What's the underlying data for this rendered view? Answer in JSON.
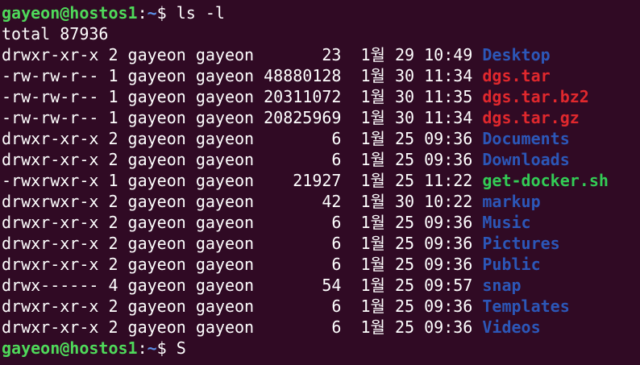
{
  "prompt": {
    "user_host": "gayeon@hostos1",
    "separator": ":",
    "path": "~",
    "symbol": "$"
  },
  "command": "ls -l",
  "total": "total 87936",
  "entries": [
    {
      "perms": "drwxr-xr-x",
      "links": "2",
      "owner": "gayeon",
      "group": "gayeon",
      "size": "23",
      "month": "1월",
      "day": "29",
      "time": "10:49",
      "name": "Desktop",
      "kind": "dir"
    },
    {
      "perms": "-rw-rw-r--",
      "links": "1",
      "owner": "gayeon",
      "group": "gayeon",
      "size": "48880128",
      "month": "1월",
      "day": "30",
      "time": "11:34",
      "name": "dgs.tar",
      "kind": "archive"
    },
    {
      "perms": "-rw-rw-r--",
      "links": "1",
      "owner": "gayeon",
      "group": "gayeon",
      "size": "20311072",
      "month": "1월",
      "day": "30",
      "time": "11:35",
      "name": "dgs.tar.bz2",
      "kind": "archive"
    },
    {
      "perms": "-rw-rw-r--",
      "links": "1",
      "owner": "gayeon",
      "group": "gayeon",
      "size": "20825969",
      "month": "1월",
      "day": "30",
      "time": "11:34",
      "name": "dgs.tar.gz",
      "kind": "archive"
    },
    {
      "perms": "drwxr-xr-x",
      "links": "2",
      "owner": "gayeon",
      "group": "gayeon",
      "size": "6",
      "month": "1월",
      "day": "25",
      "time": "09:36",
      "name": "Documents",
      "kind": "dir"
    },
    {
      "perms": "drwxr-xr-x",
      "links": "2",
      "owner": "gayeon",
      "group": "gayeon",
      "size": "6",
      "month": "1월",
      "day": "25",
      "time": "09:36",
      "name": "Downloads",
      "kind": "dir"
    },
    {
      "perms": "-rwxrwxr-x",
      "links": "1",
      "owner": "gayeon",
      "group": "gayeon",
      "size": "21927",
      "month": "1월",
      "day": "25",
      "time": "11:22",
      "name": "get-docker.sh",
      "kind": "exec"
    },
    {
      "perms": "drwxrwxr-x",
      "links": "2",
      "owner": "gayeon",
      "group": "gayeon",
      "size": "42",
      "month": "1월",
      "day": "30",
      "time": "10:22",
      "name": "markup",
      "kind": "dir"
    },
    {
      "perms": "drwxr-xr-x",
      "links": "2",
      "owner": "gayeon",
      "group": "gayeon",
      "size": "6",
      "month": "1월",
      "day": "25",
      "time": "09:36",
      "name": "Music",
      "kind": "dir"
    },
    {
      "perms": "drwxr-xr-x",
      "links": "2",
      "owner": "gayeon",
      "group": "gayeon",
      "size": "6",
      "month": "1월",
      "day": "25",
      "time": "09:36",
      "name": "Pictures",
      "kind": "dir"
    },
    {
      "perms": "drwxr-xr-x",
      "links": "2",
      "owner": "gayeon",
      "group": "gayeon",
      "size": "6",
      "month": "1월",
      "day": "25",
      "time": "09:36",
      "name": "Public",
      "kind": "dir"
    },
    {
      "perms": "drwx------",
      "links": "4",
      "owner": "gayeon",
      "group": "gayeon",
      "size": "54",
      "month": "1월",
      "day": "25",
      "time": "09:57",
      "name": "snap",
      "kind": "dir"
    },
    {
      "perms": "drwxr-xr-x",
      "links": "2",
      "owner": "gayeon",
      "group": "gayeon",
      "size": "6",
      "month": "1월",
      "day": "25",
      "time": "09:36",
      "name": "Templates",
      "kind": "dir"
    },
    {
      "perms": "drwxr-xr-x",
      "links": "2",
      "owner": "gayeon",
      "group": "gayeon",
      "size": "6",
      "month": "1월",
      "day": "25",
      "time": "09:36",
      "name": "Videos",
      "kind": "dir"
    }
  ],
  "final_input": "S",
  "colors": {
    "background": "#300a24",
    "prompt_user": "#4fd95a",
    "prompt_path": "#5b8ee6",
    "directory": "#2c57b8",
    "archive": "#e0282d",
    "executable": "#33cc55"
  }
}
